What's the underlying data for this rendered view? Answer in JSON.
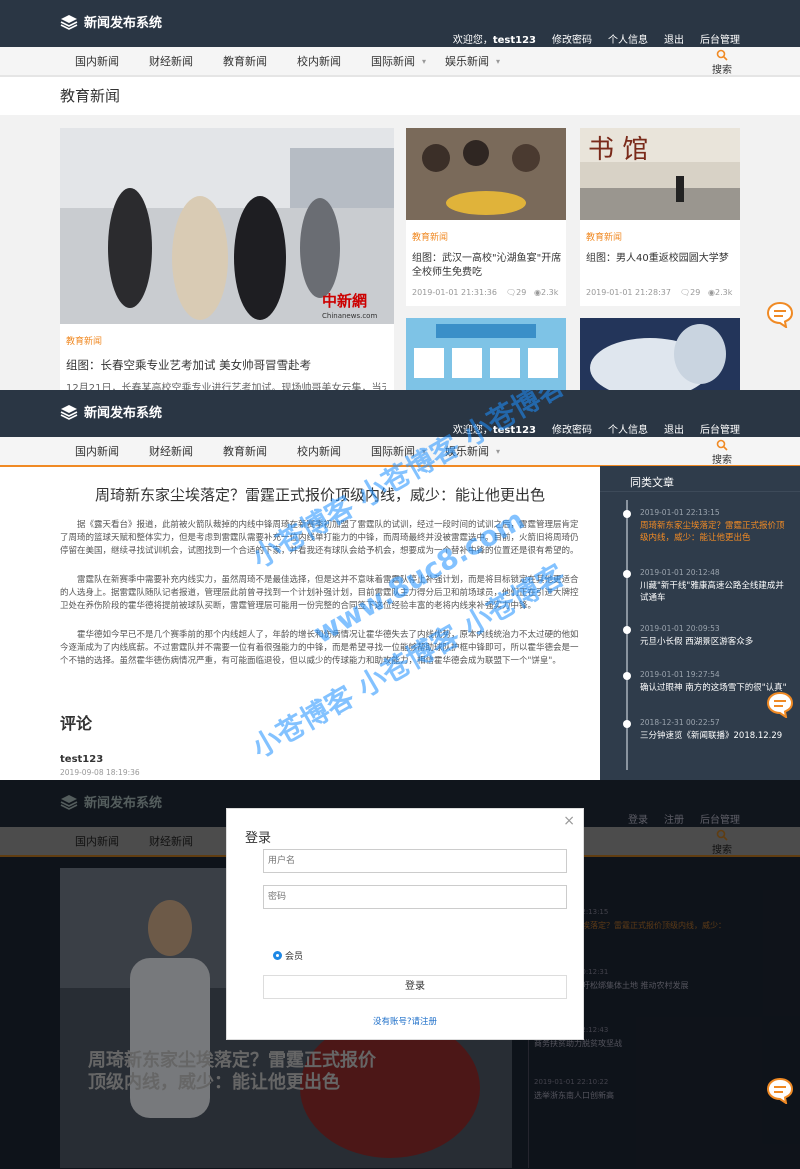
{
  "site": {
    "title": "新闻发布系统"
  },
  "userbar": {
    "welcome": "欢迎您，",
    "username": "test123",
    "change_pwd": "修改密码",
    "profile": "个人信息",
    "logout": "退出",
    "admin": "后台管理"
  },
  "guestbar": {
    "login": "登录",
    "register": "注册",
    "admin": "后台管理"
  },
  "nav": {
    "items": [
      "国内新闻",
      "财经新闻",
      "教育新闻",
      "校内新闻",
      "国际新闻",
      "娱乐新闻"
    ],
    "search": "搜索"
  },
  "edu": {
    "section_title": "教育新闻",
    "featured": {
      "tag": "教育新闻",
      "title": "组图：长春空乘专业艺考加试 美女帅哥冒雪赴考",
      "snippet": "12月21日，长春某高校空乘专业进行艺考加试。现场帅哥美女云集，当天，长春出现入",
      "photo_credit": "中新網",
      "photo_site": "Chinanews.com"
    },
    "cards": [
      {
        "tag": "教育新闻",
        "title": "组图：武汉一高校\"沁湖鱼宴\"开席 全校师生免费吃",
        "date": "2019-01-01 21:31:36",
        "comments": "29",
        "views": "2.3k"
      },
      {
        "tag": "教育新闻",
        "title": "组图：男人40重返校园圆大学梦",
        "date": "2019-01-01 21:28:37",
        "comments": "29",
        "views": "2.3k"
      }
    ]
  },
  "article": {
    "title": "周琦新东家尘埃落定？雷霆正式报价顶级内线，威少：能让他更出色",
    "paragraphs": [
      "据《露天看台》报道，此前被火箭队裁掉的内线中锋周琦在新赛季初加盟了雷霆队的试训，经过一段时间的试训之后，雷霆管理层肯定了周琦的篮球天赋和整体实力，但是考虑到雷霆队需要补充一位内线单打能力的中锋，而周琦最终并没被雷霆选中。目前，火箭旧将周琦仍停留在美国，继续寻找试训机会，试图找到一个合适的下家，并看我还有球队会给予机会，想要成为一个替补中锋的位置还是很有希望的。",
      "雷霆队在新赛季中需要补充内线实力，虽然周琦不是最佳选择，但是这并不意味着雷霆队停止补强计划，而是将目标锁定在其他更适合的人选身上。据雷霆队随队记者报道，管理层此前曾寻找到一个计划补强计划，目前雷霆队主力得分后卫和前场球员，他们正在引进大牌控卫处在养伤阶段的霍华德将提前被球队买断，雷霆管理层可能用一份完整的合同签下这位经验丰富的老将内线来补强实力中锋。",
      "霍华德如今早已不是几个赛季前的那个内线超人了，年龄的增长和伤病情况让霍华德失去了内线优势，原本内线统治力不太过硬的他如今逐渐成为了内线底薪。不过雷霆队并不需要一位有着很强能力的中锋，而是希望寻找一位能够帮助球队护框中锋即可，所以霍华德会是一个不错的选择。虽然霍华德伤病情况严重，有可能面临退役，但以威少的传球能力和助攻能力，相信霍华德会成为联盟下一个\"饼皇\"。"
    ],
    "comments_heading": "评论",
    "comment": {
      "user": "test123",
      "date": "2019-09-08 18:19:36"
    }
  },
  "sidebar": {
    "heading": "同类文章",
    "items": [
      {
        "date": "2019-01-01 22:13:15",
        "title": "周琦新东家尘埃落定？雷霆正式报价顶级内线，威少：能让他更出色"
      },
      {
        "date": "2019-01-01 20:12:48",
        "title": "川藏\"新干线\"雅康高速公路全线建成并试通车"
      },
      {
        "date": "2019-01-01 20:09:53",
        "title": "元旦小长假 西湖景区游客众多"
      },
      {
        "date": "2019-01-01 19:27:54",
        "title": "确认过眼神 南方的这场雪下的很\"认真\""
      },
      {
        "date": "2018-12-31 00:22:57",
        "title": "三分钟速览《新闻联播》2018.12.29"
      }
    ]
  },
  "watermark": {
    "text1": "小苍博客 小苍博客 小苍博客",
    "text2": "www.8uc8.com"
  },
  "login": {
    "title": "登录",
    "close": "×",
    "username_placeholder": "用户名",
    "password_placeholder": "密码",
    "role": "会员",
    "submit": "登录",
    "register_link": "没有账号?请注册"
  },
  "bg3": {
    "hero_title": "周琦新东家尘埃落定？雷霆正式报价顶级内线，威少：能让他更出色",
    "side_dates": [
      "2019-01-01 22:13:15",
      "2019-01-01 20:12:31",
      "2019-01-01 22:12:43",
      "2019-01-01 22:10:22"
    ],
    "side_titles": [
      "周琦新东家尘埃落定？雷霆正式报价顶级内线，威少：",
      "新闻：各方呼吁松绑集体土地 推动农村发展",
      "商务扶贫助力脱贫攻坚战",
      "选举浙东南人口创新高"
    ]
  },
  "colors": {
    "header": "#2a3644",
    "accent": "#f08a24",
    "link": "#1e6fc9"
  }
}
